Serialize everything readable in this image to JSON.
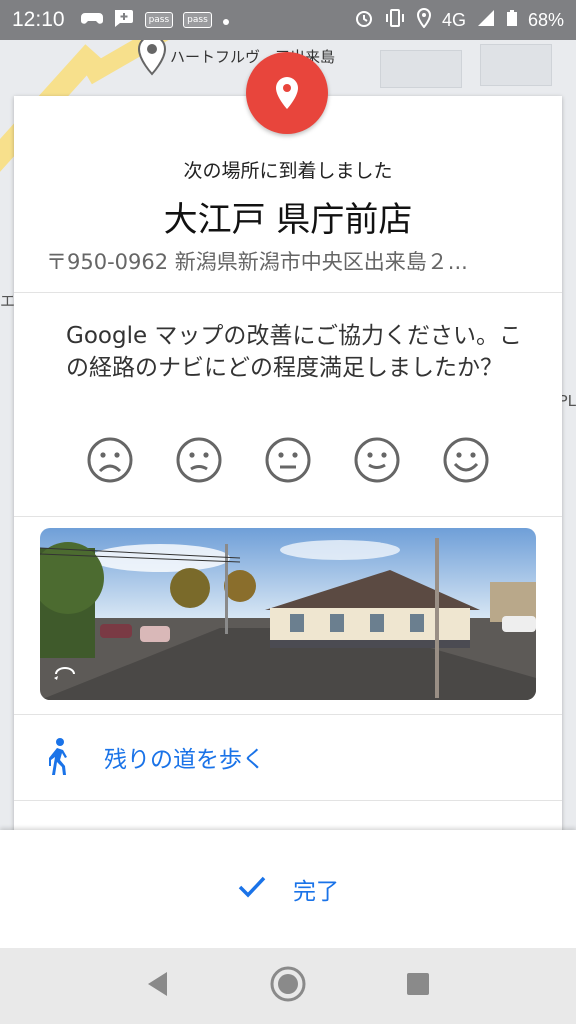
{
  "status_bar": {
    "time": "12:10",
    "pass_label_1": "pass",
    "pass_label_2": "pass",
    "network": "4G",
    "battery": "68%"
  },
  "map": {
    "poi_label": "ハートフルヴ　三出来島",
    "side_left": "エ",
    "side_right": "PL"
  },
  "card": {
    "arrived_text": "次の場所に到着しました",
    "place_name": "大江戸 県庁前店",
    "address": "〒950-0962 新潟県新潟市中央区出来島２...",
    "survey_question": "Google マップの改善にご協力ください。この経路のナビにどの程度満足しましたか？",
    "faces": [
      "very-dissatisfied",
      "dissatisfied",
      "neutral",
      "satisfied",
      "very-satisfied"
    ],
    "walk_label": "残りの道を歩く"
  },
  "bottom": {
    "done_label": "完了"
  },
  "colors": {
    "accent_blue": "#1a73e8",
    "pin_red": "#e8453c"
  }
}
